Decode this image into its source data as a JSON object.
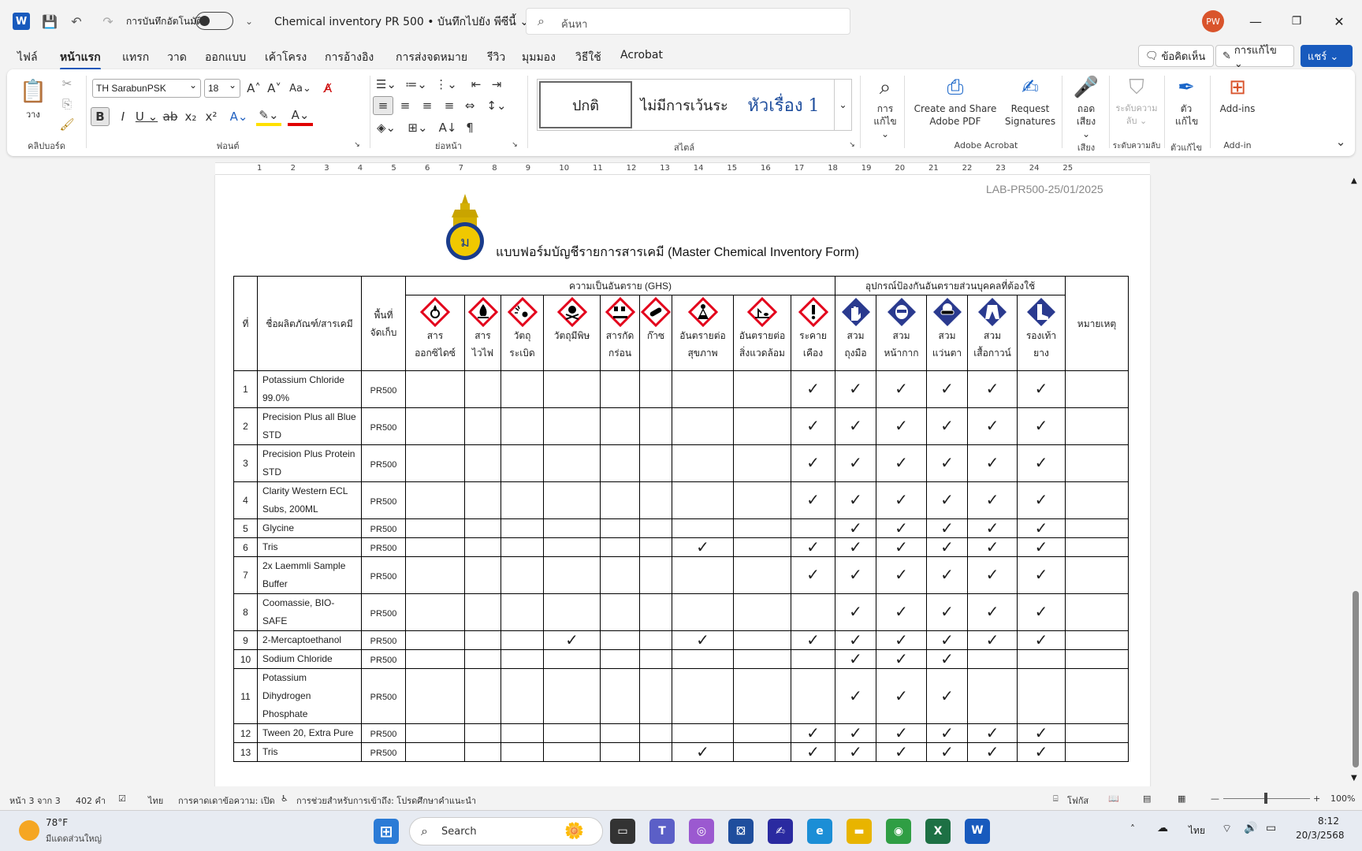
{
  "titlebar": {
    "autosave_label": "การบันทึกอัตโนมัติ",
    "doc_title": "Chemical inventory PR 500 • บันทึกไปยัง พีซีนี้ ⌄",
    "search_placeholder": "ค้นหา",
    "avatar_initials": "PW"
  },
  "menu": {
    "tabs": [
      "ไฟล์",
      "หน้าแรก",
      "แทรก",
      "วาด",
      "ออกแบบ",
      "เค้าโครง",
      "การอ้างอิง",
      "การส่งจดหมาย",
      "รีวิว",
      "มุมมอง",
      "วิธีใช้",
      "Acrobat"
    ],
    "comments_label": "ข้อคิดเห็น",
    "editing_label": "การแก้ไข ⌄",
    "share_label": "แชร์ ⌄"
  },
  "ribbon": {
    "clipboard": {
      "paste_label": "วาง",
      "group_label": "คลิปบอร์ด"
    },
    "font": {
      "font_name": "TH SarabunPSK",
      "font_size": "18",
      "group_label": "ฟอนต์"
    },
    "paragraph": {
      "group_label": "ย่อหน้า"
    },
    "styles": {
      "normal": "ปกติ",
      "no_spacing": "ไม่มีการเว้นระ",
      "heading1": "หัวเรื่อง 1",
      "group_label": "สไตล์"
    },
    "editing": {
      "label": "การ แก้ไข ⌄"
    },
    "acrobat": {
      "create_share": "Create and Share Adobe PDF",
      "request_signatures": "Request Signatures",
      "group_label": "Adobe Acrobat"
    },
    "voice": {
      "dictate": "ถอด เสียง ⌄",
      "group_label": "เสียง"
    },
    "sensitivity": {
      "label": "ระดับความ ลับ ⌄",
      "group_label": "ระดับความลับ"
    },
    "editor": {
      "label": "ตัว แก้ไข",
      "group_label": "ตัวแก้ไข"
    },
    "addins": {
      "label": "Add-ins",
      "group_label": "Add-in"
    }
  },
  "ruler": {
    "numbers": [
      "1",
      "2",
      "3",
      "4",
      "5",
      "6",
      "7",
      "8",
      "9",
      "10",
      "11",
      "12",
      "13",
      "14",
      "15",
      "16",
      "17",
      "18",
      "19",
      "20",
      "21",
      "22",
      "23",
      "24",
      "25"
    ]
  },
  "document": {
    "doc_id": "LAB-PR500-25/01/2025",
    "form_title": "แบบฟอร์มบัญชีรายการสารเคมี (Master Chemical Inventory Form)",
    "headers": {
      "no": "ที่",
      "name": "ชื่อผลิตภัณฑ์/สารเคมี",
      "storage_1": "พื้นที่",
      "storage_2": "จัดเก็บ",
      "ghs_group": "ความเป็นอันตราย (GHS)",
      "ppe_group": "อุปกรณ์ป้องกันอันตรายส่วนบุคคลที่ต้องใช้",
      "remarks": "หมายเหตุ",
      "ghs_cols": [
        {
          "l1": "สาร",
          "l2": "ออกซิไดซ์",
          "icon": "oxidizer-icon"
        },
        {
          "l1": "สาร",
          "l2": "ไวไฟ",
          "icon": "flammable-icon"
        },
        {
          "l1": "วัตถุ",
          "l2": "ระเบิด",
          "icon": "explosive-icon"
        },
        {
          "l1": "วัตถุมีพิษ",
          "l2": "",
          "icon": "toxic-skull-icon"
        },
        {
          "l1": "สารกัด",
          "l2": "กร่อน",
          "icon": "corrosive-icon"
        },
        {
          "l1": "ก๊าซ",
          "l2": "",
          "icon": "gas-cylinder-icon"
        },
        {
          "l1": "อันตรายต่อ",
          "l2": "สุขภาพ",
          "icon": "health-hazard-icon"
        },
        {
          "l1": "อันตรายต่อ",
          "l2": "สิ่งแวดล้อม",
          "icon": "environment-icon"
        },
        {
          "l1": "ระคาย",
          "l2": "เคือง",
          "icon": "irritant-exclamation-icon"
        }
      ],
      "ppe_cols": [
        {
          "l1": "สวม",
          "l2": "ถุงมือ",
          "icon": "gloves-icon"
        },
        {
          "l1": "สวม",
          "l2": "หน้ากาก",
          "icon": "mask-icon"
        },
        {
          "l1": "สวม",
          "l2": "แว่นตา",
          "icon": "goggles-icon"
        },
        {
          "l1": "สวม",
          "l2": "เสื้อกาวน์",
          "icon": "lab-coat-icon"
        },
        {
          "l1": "รองเท้า",
          "l2": "ยาง",
          "icon": "boots-icon"
        }
      ]
    },
    "check_mark": "✓",
    "rows": [
      {
        "no": "1",
        "name": "Potassium Chloride 99.0%",
        "loc": "PR500",
        "checks": [
          0,
          0,
          0,
          0,
          0,
          0,
          0,
          0,
          1,
          1,
          1,
          1,
          1,
          1
        ],
        "lines": 2
      },
      {
        "no": "2",
        "name": "Precision Plus all Blue STD",
        "loc": "PR500",
        "checks": [
          0,
          0,
          0,
          0,
          0,
          0,
          0,
          0,
          1,
          1,
          1,
          1,
          1,
          1
        ],
        "lines": 2
      },
      {
        "no": "3",
        "name": "Precision Plus Protein STD",
        "loc": "PR500",
        "checks": [
          0,
          0,
          0,
          0,
          0,
          0,
          0,
          0,
          1,
          1,
          1,
          1,
          1,
          1
        ],
        "lines": 2
      },
      {
        "no": "4",
        "name": "Clarity Western ECL Subs, 200ML",
        "loc": "PR500",
        "checks": [
          0,
          0,
          0,
          0,
          0,
          0,
          0,
          0,
          1,
          1,
          1,
          1,
          1,
          1
        ],
        "lines": 2
      },
      {
        "no": "5",
        "name": "Glycine",
        "loc": "PR500",
        "checks": [
          0,
          0,
          0,
          0,
          0,
          0,
          0,
          0,
          0,
          1,
          1,
          1,
          1,
          1
        ],
        "lines": 1
      },
      {
        "no": "6",
        "name": "Tris",
        "loc": "PR500",
        "checks": [
          0,
          0,
          0,
          0,
          0,
          0,
          1,
          0,
          1,
          1,
          1,
          1,
          1,
          1
        ],
        "lines": 1
      },
      {
        "no": "7",
        "name": "2x Laemmli Sample Buffer",
        "loc": "PR500",
        "checks": [
          0,
          0,
          0,
          0,
          0,
          0,
          0,
          0,
          1,
          1,
          1,
          1,
          1,
          1
        ],
        "lines": 2
      },
      {
        "no": "8",
        "name": "Coomassie, BIO-SAFE",
        "loc": "PR500",
        "checks": [
          0,
          0,
          0,
          0,
          0,
          0,
          0,
          0,
          0,
          1,
          1,
          1,
          1,
          1
        ],
        "lines": 1
      },
      {
        "no": "9",
        "name": "2-Mercaptoethanol",
        "loc": "PR500",
        "checks": [
          0,
          0,
          0,
          1,
          0,
          0,
          1,
          0,
          1,
          1,
          1,
          1,
          1,
          1
        ],
        "lines": 1
      },
      {
        "no": "10",
        "name": "Sodium Chloride",
        "loc": "PR500",
        "checks": [
          0,
          0,
          0,
          0,
          0,
          0,
          0,
          0,
          0,
          1,
          1,
          1,
          0,
          0
        ],
        "lines": 1
      },
      {
        "no": "11",
        "name": "Potassium Dihydrogen Phosphate",
        "loc": "PR500",
        "checks": [
          0,
          0,
          0,
          0,
          0,
          0,
          0,
          0,
          0,
          1,
          1,
          1,
          0,
          0
        ],
        "lines": 3
      },
      {
        "no": "12",
        "name": "Tween 20, Extra Pure",
        "loc": "PR500",
        "checks": [
          0,
          0,
          0,
          0,
          0,
          0,
          0,
          0,
          1,
          1,
          1,
          1,
          1,
          1
        ],
        "lines": 1
      },
      {
        "no": "13",
        "name": "Tris",
        "loc": "PR500",
        "checks": [
          0,
          0,
          0,
          0,
          0,
          0,
          1,
          0,
          1,
          1,
          1,
          1,
          1,
          1
        ],
        "lines": 1
      }
    ]
  },
  "statusbar": {
    "page": "หน้า 3 จาก 3",
    "words": "402 คำ",
    "language": "ไทย",
    "predictions": "การคาดเดาข้อความ: เปิด",
    "accessibility": "การช่วยสำหรับการเข้าถึง: โปรดศึกษาคำแนะนำ",
    "focus": "โฟกัส",
    "zoom": "100%"
  },
  "taskbar": {
    "weather_temp": "78°F",
    "weather_desc": "มีแดดส่วนใหญ่",
    "search_label": "Search",
    "lang": "ไทย",
    "time": "8:12",
    "date": "20/3/2568"
  },
  "colors": {
    "word_blue": "#185abd",
    "ghs_red": "#e3001b",
    "ppe_blue": "#2a3a8f"
  }
}
